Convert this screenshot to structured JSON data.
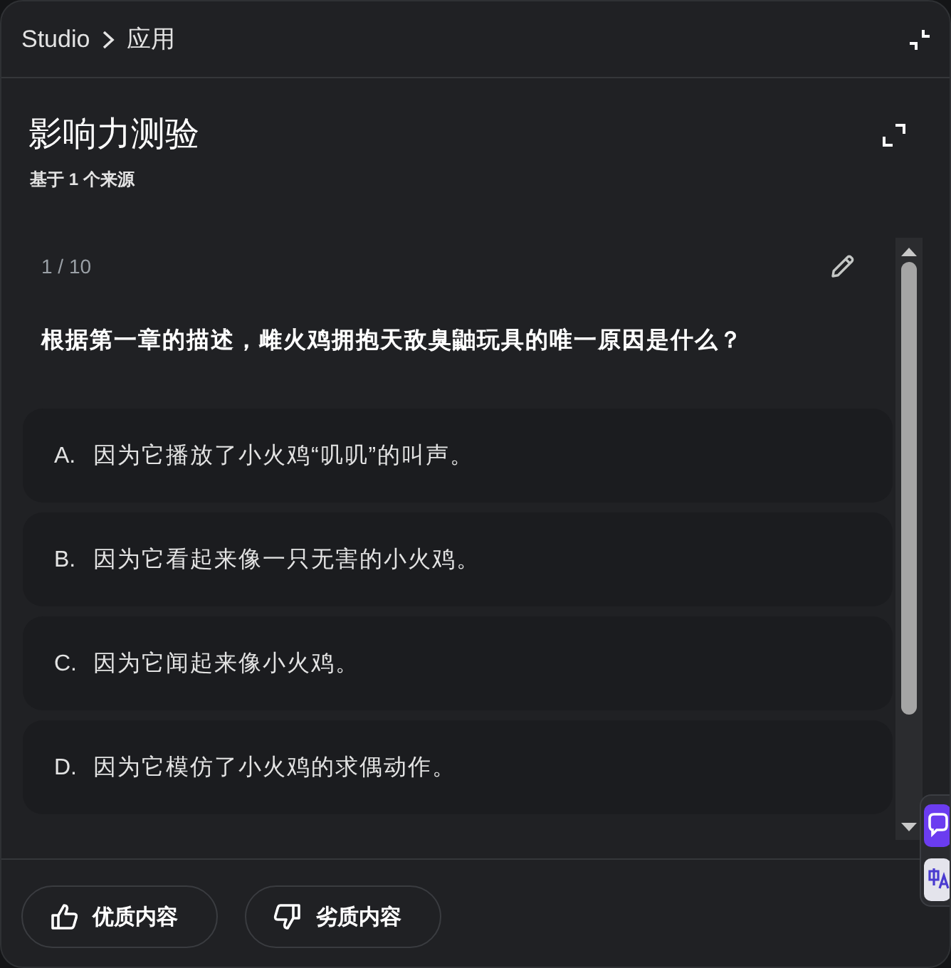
{
  "breadcrumb": [
    "Studio",
    "应用"
  ],
  "heading": {
    "title": "影响力测验",
    "subtitle": "基于 1 个来源"
  },
  "quiz": {
    "progress": "1 / 10",
    "question": "根据第一章的描述，雌火鸡拥抱天敌臭鼬玩具的唯一原因是什么？",
    "options": [
      {
        "letter": "A.",
        "text": "因为它播放了小火鸡“叽叽”的叫声。"
      },
      {
        "letter": "B.",
        "text": "因为它看起来像一只无害的小火鸡。"
      },
      {
        "letter": "C.",
        "text": "因为它闻起来像小火鸡。"
      },
      {
        "letter": "D.",
        "text": "因为它模仿了小火鸡的求偶动作。"
      }
    ]
  },
  "feedback": [
    {
      "kind": "good",
      "label": "优质内容"
    },
    {
      "kind": "bad",
      "label": "劣质内容"
    }
  ]
}
